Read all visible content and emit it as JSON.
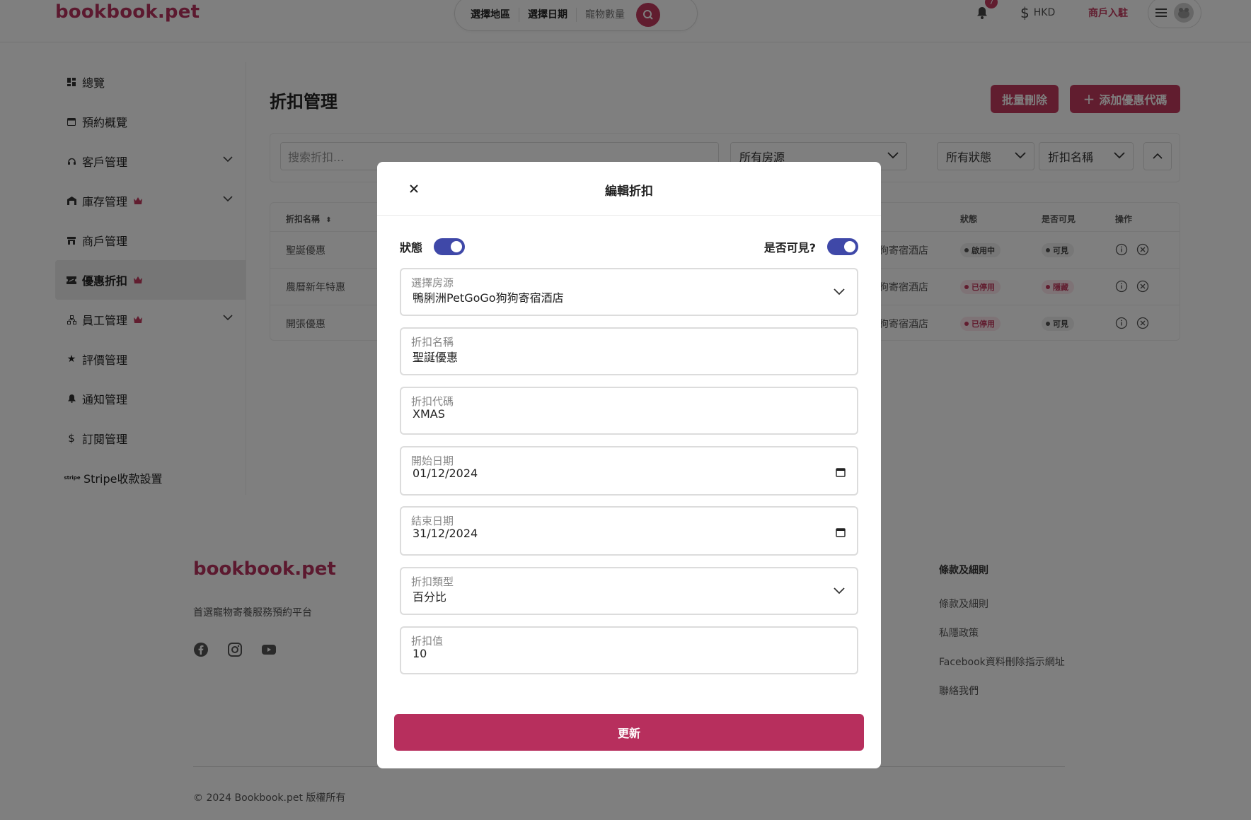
{
  "header": {
    "logo": "bookbook.pet",
    "search": {
      "region": "選擇地區",
      "date": "選擇日期",
      "pets": "寵物數量"
    },
    "notification_count": "7",
    "currency": "HKD",
    "merchant_link": "商戶入駐"
  },
  "sidebar": {
    "items": [
      {
        "label": "總覽",
        "icon": "dashboard-icon"
      },
      {
        "label": "預約概覽",
        "icon": "calendar-icon"
      },
      {
        "label": "客戶管理",
        "icon": "headset-icon",
        "expandable": true
      },
      {
        "label": "庫存管理",
        "icon": "warehouse-icon",
        "crown": true,
        "expandable": true
      },
      {
        "label": "商戶管理",
        "icon": "store-icon"
      },
      {
        "label": "優惠折扣",
        "icon": "ticket-icon",
        "crown": true,
        "active": true
      },
      {
        "label": "員工管理",
        "icon": "org-chart-icon",
        "crown": true,
        "expandable": true
      },
      {
        "label": "評價管理",
        "icon": "star-icon"
      },
      {
        "label": "通知管理",
        "icon": "bell-icon"
      },
      {
        "label": "訂閱管理",
        "icon": "dollar-icon"
      },
      {
        "label": "Stripe收款設置",
        "icon": "stripe-icon"
      }
    ]
  },
  "main": {
    "title": "折扣管理",
    "bulk_delete": "批量刪除",
    "add_code": "添加優惠代碼",
    "filters": {
      "search_placeholder": "搜索折扣...",
      "property": "所有房源",
      "status": "所有狀態",
      "sort": "折扣名稱"
    },
    "table": {
      "headers": {
        "name": "折扣名稱",
        "status": "狀態",
        "visible": "是否可見",
        "action": "操作"
      },
      "rows": [
        {
          "name": "聖誕優惠",
          "property_fragment": "狗寄宿酒店",
          "status": "啟用中",
          "visible": "可見"
        },
        {
          "name": "農曆新年特惠",
          "property_fragment": "狗寄宿酒店",
          "status": "已停用",
          "visible": "隱藏"
        },
        {
          "name": "開張優惠",
          "property_fragment": "狗寄宿酒店",
          "status": "已停用",
          "visible": "可見"
        }
      ]
    }
  },
  "footer": {
    "logo": "bookbook.pet",
    "tagline": "首選寵物寄養服務預約平台",
    "terms_title": "條款及細則",
    "links": [
      "條款及細則",
      "私隱政策",
      "Facebook資料刪除指示網址",
      "聯絡我們"
    ],
    "copyright": "© 2024 Bookbook.pet 版權所有"
  },
  "modal": {
    "title": "編輯折扣",
    "status_label": "狀態",
    "visible_label": "是否可見?",
    "fields": {
      "property": {
        "label": "選擇房源",
        "value": "鴨脷洲PetGoGo狗狗寄宿酒店"
      },
      "name": {
        "label": "折扣名稱",
        "value": "聖誕優惠"
      },
      "code": {
        "label": "折扣代碼",
        "value": "XMAS"
      },
      "start_date": {
        "label": "開始日期",
        "value": "01/12/2024"
      },
      "end_date": {
        "label": "結束日期",
        "value": "31/12/2024"
      },
      "type": {
        "label": "折扣類型",
        "value": "百分比"
      },
      "value": {
        "label": "折扣值",
        "value": "10"
      }
    },
    "submit": "更新"
  },
  "colors": {
    "brand": "#c23a5f",
    "toggle": "#3f48a8",
    "overlay": "rgba(0,0,0,0.5)"
  }
}
